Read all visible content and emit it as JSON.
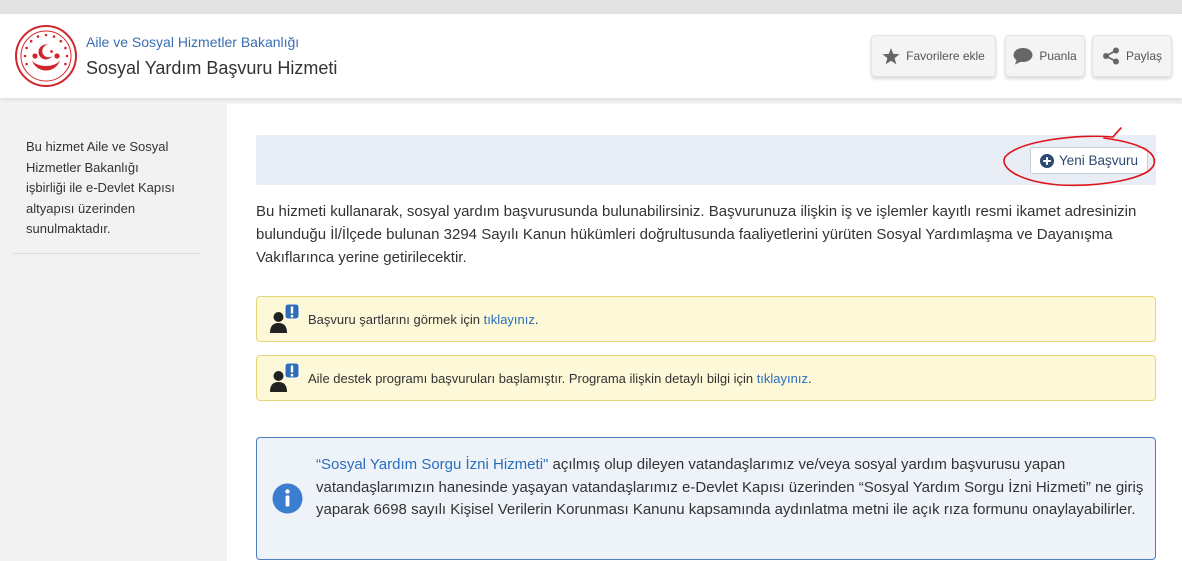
{
  "colors": {
    "ministry_blue": "#3a6db3",
    "link_blue": "#2a6ebb",
    "emblem_red": "#d1262e",
    "annotation_red": "#e0131b",
    "alert_bg": "#fcf8d8",
    "alert_border": "#e6d67a",
    "info_bg": "#eef3f9",
    "info_border": "#4a7fc1",
    "info_icon": "#3b7dd0"
  },
  "header": {
    "logo_icon": "ministry-emblem-icon",
    "ministry_name": "Aile ve Sosyal Hizmetler Bakanlığı",
    "service_title": "Sosyal Yardım Başvuru Hizmeti",
    "actions": [
      {
        "label": "Favorilere ekle",
        "icon": "star-icon"
      },
      {
        "label": "Puanla",
        "icon": "speech-bubble-icon"
      },
      {
        "label": "Paylaş",
        "icon": "share-icon"
      }
    ]
  },
  "sidebar": {
    "info_text": "Bu hizmet Aile ve Sosyal Hizmetler Bakanlığı işbirliği ile e-Devlet Kapısı altyapısı üzerinden sunulmaktadır."
  },
  "main": {
    "toolbar": {
      "new_application_label": "Yeni Başvuru",
      "new_application_icon": "plus-circle-icon"
    },
    "description": "Bu hizmeti kullanarak, sosyal yardım başvurusunda bulunabilirsiniz. Başvurunuza ilişkin iş ve işlemler kayıtlı resmi ikamet adresinizin bulunduğu İl/İlçede bulunan 3294 Sayılı Kanun hükümleri doğrultusunda faaliyetlerini yürüten Sosyal Yardımlaşma ve Dayanışma Vakıflarınca yerine getirilecektir.",
    "alerts": [
      {
        "icon": "user-alert-icon",
        "text": "Başvuru şartlarını görmek için ",
        "link": "tıklayınız",
        "suffix": "."
      },
      {
        "icon": "user-alert-icon",
        "text": "Aile destek programı başvuruları başlamıştır. Programa ilişkin detaylı bilgi için ",
        "link": "tıklayınız",
        "suffix": "."
      }
    ],
    "info": {
      "icon": "info-circle-icon",
      "link": "“Sosyal Yardım Sorgu İzni Hizmeti\"",
      "text": " açılmış olup dileyen vatandaşlarımız ve/veya sosyal yardım başvurusu yapan vatandaşlarımızın hanesinde yaşayan vatandaşlarımız e-Devlet Kapısı üzerinden “Sosyal Yardım Sorgu İzni Hizmeti” ne giriş yaparak 6698 sayılı Kişisel Verilerin Korunması Kanunu kapsamında aydınlatma metni ile açık rıza formunu onaylayabilirler."
    }
  }
}
